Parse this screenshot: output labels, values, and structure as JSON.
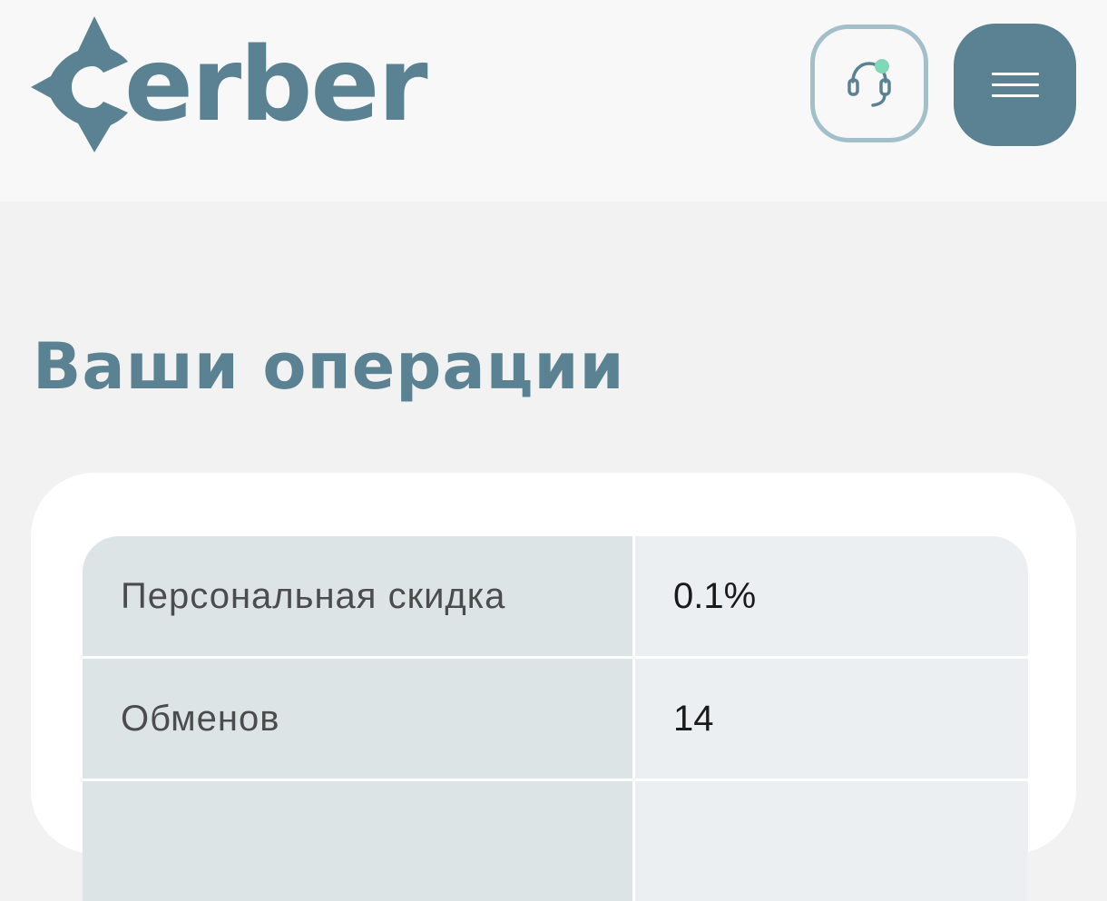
{
  "header": {
    "logo_text": "erber",
    "logo_lettering": "Cerber",
    "support_icon": "headset-icon",
    "menu_icon": "hamburger-menu-icon"
  },
  "main": {
    "title": "Ваши операции",
    "stats": [
      {
        "label": "Персональная скидка",
        "value": "0.1%"
      },
      {
        "label": "Обменов",
        "value": "14"
      },
      {
        "label": "",
        "value": ""
      }
    ]
  },
  "colors": {
    "brand": "#5b8292",
    "brand_light": "#a3bfca",
    "status_dot": "#7fd8b8",
    "label_cell": "#dce4e6",
    "value_cell": "#ebeff2"
  }
}
